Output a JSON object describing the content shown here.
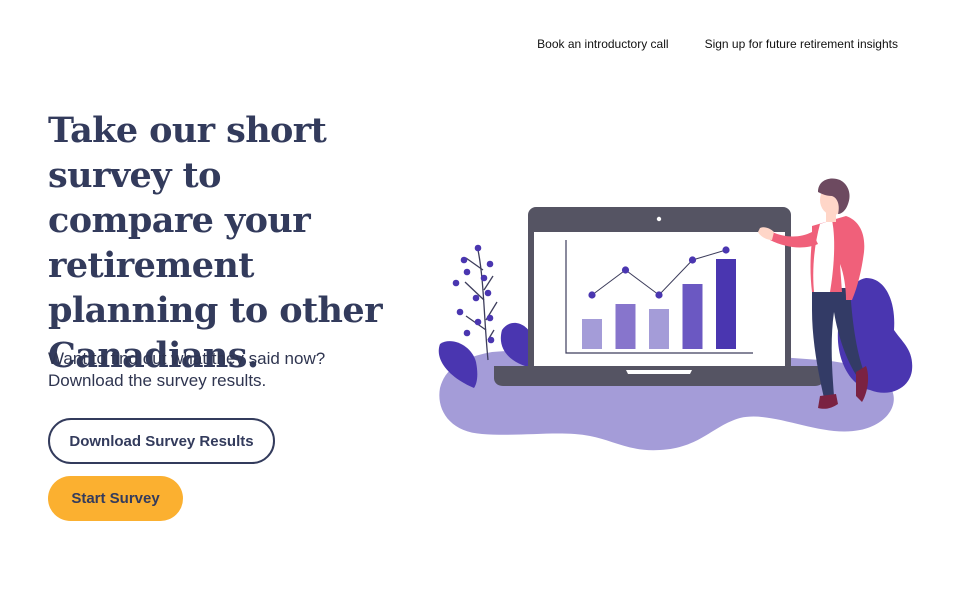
{
  "nav": {
    "links": [
      {
        "label": "Book an introductory call"
      },
      {
        "label": "Sign up for future retirement insights"
      }
    ]
  },
  "hero": {
    "title": "Take our short survey to compare your retirement planning to other Canadians.",
    "subtitle_lines": [
      "Want to find out what they said now?",
      "Download the survey results."
    ],
    "buttons": {
      "download_label": "Download Survey Results",
      "start_label": "Start Survey"
    }
  },
  "colors": {
    "heading": "#333b5c",
    "accent_yellow": "#fbb030",
    "illustration_purple": "#4a36b0",
    "blob_lavender": "#a49cd8"
  },
  "illustration": {
    "icon": "person-presenting-bar-chart-on-laptop-illustration",
    "bar_values": [
      3,
      4.5,
      4,
      6.5,
      9
    ],
    "line_values": [
      5.5,
      8,
      5.5,
      9,
      10
    ]
  }
}
